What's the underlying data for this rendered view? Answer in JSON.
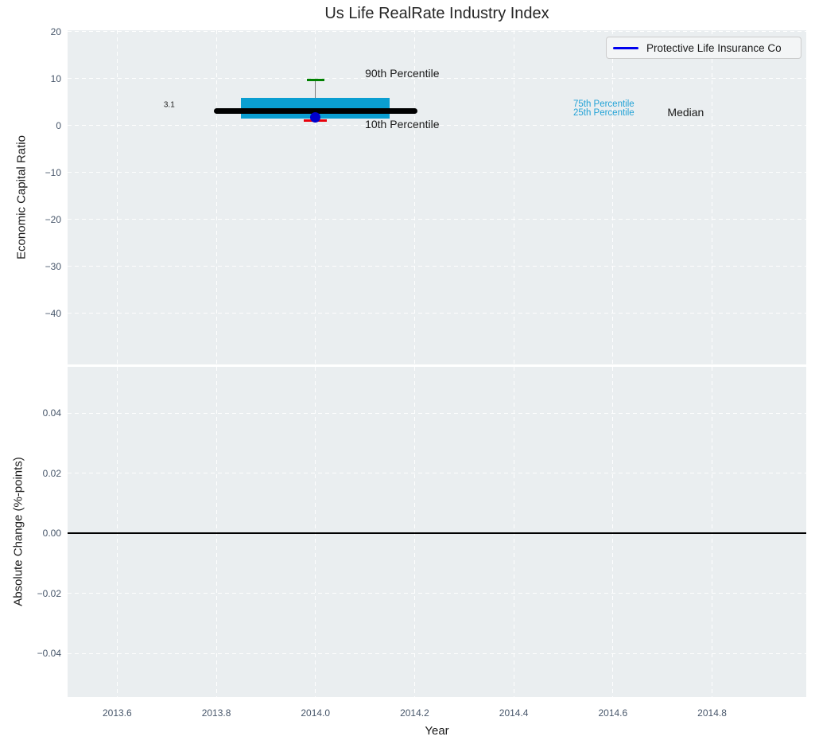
{
  "title": "Us Life RealRate Industry Index",
  "legend": {
    "label": "Protective Life Insurance Co",
    "line_color": "#0000ee"
  },
  "colors": {
    "figure_bg": "#ffffff",
    "plot_bg": "#eaeef0",
    "grid": "#ffffff",
    "box_fill": "#0a9ed1",
    "median_line": "#000000",
    "whisker": "#7a7a7a",
    "cap_90th": "#008000",
    "cap_10th": "#e8000b",
    "company_point": "#0000cc",
    "zero_line": "#000000",
    "tick_text": "#47566a",
    "percentile_text": "#22a2d6",
    "annotation_text": "#1a1a1a"
  },
  "chart_data": [
    {
      "type": "box",
      "title": "Us Life RealRate Industry Index",
      "ylabel": "Economic Capital Ratio",
      "xlim": [
        2013.5,
        2014.99
      ],
      "ylim": [
        -50.9,
        20.3
      ],
      "grid": "dashed-white",
      "xticks": {
        "values": [
          2013.6,
          2013.8,
          2014.0,
          2014.2,
          2014.4,
          2014.6,
          2014.8
        ],
        "labels": [
          "2013.6",
          "2013.8",
          "2014.0",
          "2014.2",
          "2014.4",
          "2014.6",
          "2014.8"
        ]
      },
      "yticks": {
        "values": [
          20,
          10,
          0,
          -10,
          -20,
          -30,
          -40
        ],
        "labels": [
          "20",
          "10",
          "0",
          "−10",
          "−20",
          "−30",
          "−40"
        ]
      },
      "box": {
        "x": 2014.0,
        "p90": 9.7,
        "p75": 5.9,
        "median": 3.1,
        "p25": 1.5,
        "p10": 1.1,
        "box_half_width": 0.15,
        "median_half_width": 0.205,
        "cap90_half_width": 0.018,
        "cap10_half_width": 0.023
      },
      "company_point": {
        "name": "Protective Life Insurance Co",
        "x": 2014.0,
        "y": 1.7
      },
      "annotations": [
        {
          "name": "median-value-label",
          "text": "3.1",
          "x": 2013.705,
          "y": 4.3,
          "size": 10,
          "color": "#1a1a1a",
          "anchor": "center"
        },
        {
          "name": "p90-label",
          "text": "90th Percentile",
          "x": 2014.1,
          "y": 11.1,
          "size": 14,
          "color": "#1a1a1a",
          "anchor": "left"
        },
        {
          "name": "p10-label",
          "text": "10th Percentile",
          "x": 2014.1,
          "y": 0.3,
          "size": 14,
          "color": "#1a1a1a",
          "anchor": "left"
        },
        {
          "name": "p75-label",
          "text": "75th Percentile",
          "x": 2014.52,
          "y": 4.6,
          "size": 11.5,
          "color": "#22a2d6",
          "anchor": "left"
        },
        {
          "name": "p25-label",
          "text": "25th Percentile",
          "x": 2014.52,
          "y": 2.7,
          "size": 11.5,
          "color": "#22a2d6",
          "anchor": "left"
        },
        {
          "name": "median-label",
          "text": "Median",
          "x": 2014.71,
          "y": 2.8,
          "size": 14,
          "color": "#1a1a1a",
          "anchor": "left"
        }
      ],
      "legend_entries": [
        "Protective Life Insurance Co"
      ]
    },
    {
      "type": "line",
      "ylabel": "Absolute Change (%-points)",
      "xlabel": "Year",
      "xlim": [
        2013.5,
        2014.99
      ],
      "ylim": [
        -0.0545,
        0.0555
      ],
      "grid": "dashed-white",
      "yticks": {
        "values": [
          0.04,
          0.02,
          0.0,
          -0.02,
          -0.04
        ],
        "labels": [
          "0.04",
          "0.02",
          "0.00",
          "−0.02",
          "−0.04"
        ]
      },
      "zero_line": 0.0,
      "series": []
    }
  ]
}
